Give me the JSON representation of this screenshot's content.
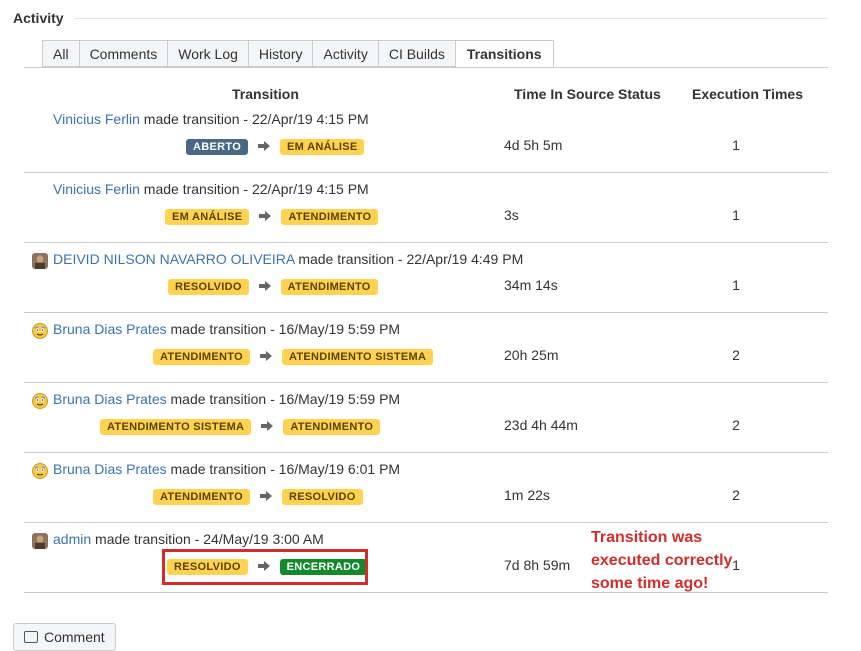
{
  "section": {
    "title": "Activity"
  },
  "tabs": [
    {
      "label": "All",
      "active": false
    },
    {
      "label": "Comments",
      "active": false
    },
    {
      "label": "Work Log",
      "active": false
    },
    {
      "label": "History",
      "active": false
    },
    {
      "label": "Activity",
      "active": false
    },
    {
      "label": "CI Builds",
      "active": false
    },
    {
      "label": "Transitions",
      "active": true
    }
  ],
  "table": {
    "headers": [
      "Transition",
      "Time In Source Status",
      "Execution Times"
    ],
    "rows": [
      {
        "user": "Vinicius Ferlin",
        "action": " made transition - ",
        "date": "22/Apr/19 4:15 PM",
        "avatar": "none",
        "from": "ABERTO",
        "from_color": "blue",
        "to": "EM ANÁLISE",
        "to_color": "yellow",
        "time": "4d 5h 5m",
        "exec": "1"
      },
      {
        "user": "Vinicius Ferlin",
        "action": " made transition - ",
        "date": "22/Apr/19 4:15 PM",
        "avatar": "none",
        "from": "EM ANÁLISE",
        "from_color": "yellow",
        "to": "ATENDIMENTO",
        "to_color": "yellow",
        "time": "3s",
        "exec": "1"
      },
      {
        "user": "DEIVID NILSON NAVARRO OLIVEIRA",
        "action": " made transition - ",
        "date": "22/Apr/19 4:49 PM",
        "avatar": "photo",
        "from": "RESOLVIDO",
        "from_color": "yellow",
        "to": "ATENDIMENTO",
        "to_color": "yellow",
        "time": "34m 14s",
        "exec": "1"
      },
      {
        "user": "Bruna Dias Prates",
        "action": " made transition - ",
        "date": "16/May/19 5:59 PM",
        "avatar": "face",
        "from": "ATENDIMENTO",
        "from_color": "yellow",
        "to": "ATENDIMENTO SISTEMA",
        "to_color": "yellow",
        "time": "20h 25m",
        "exec": "2"
      },
      {
        "user": "Bruna Dias Prates",
        "action": " made transition - ",
        "date": "16/May/19 5:59 PM",
        "avatar": "face",
        "from": "ATENDIMENTO SISTEMA",
        "from_color": "yellow",
        "to": "ATENDIMENTO",
        "to_color": "yellow",
        "time": "23d 4h 44m",
        "exec": "2"
      },
      {
        "user": "Bruna Dias Prates",
        "action": " made transition - ",
        "date": "16/May/19 6:01 PM",
        "avatar": "face",
        "from": "ATENDIMENTO",
        "from_color": "yellow",
        "to": "RESOLVIDO",
        "to_color": "yellow",
        "time": "1m 22s",
        "exec": "2"
      },
      {
        "user": "admin",
        "action": " made transition - ",
        "date": "24/May/19 3:00 AM",
        "avatar": "photo",
        "from": "RESOLVIDO",
        "from_color": "yellow",
        "to": "ENCERRADO",
        "to_color": "green",
        "time": "7d 8h 59m",
        "exec": "1"
      }
    ]
  },
  "annotation": {
    "text": "Transition was executed correctly some time ago!",
    "color": "#d22d2d"
  },
  "footer": {
    "comment_label": "Comment"
  },
  "colors": {
    "link": "#3b73af",
    "yellow": "#ffd351",
    "blue": "#4a6785",
    "green": "#14892c"
  }
}
